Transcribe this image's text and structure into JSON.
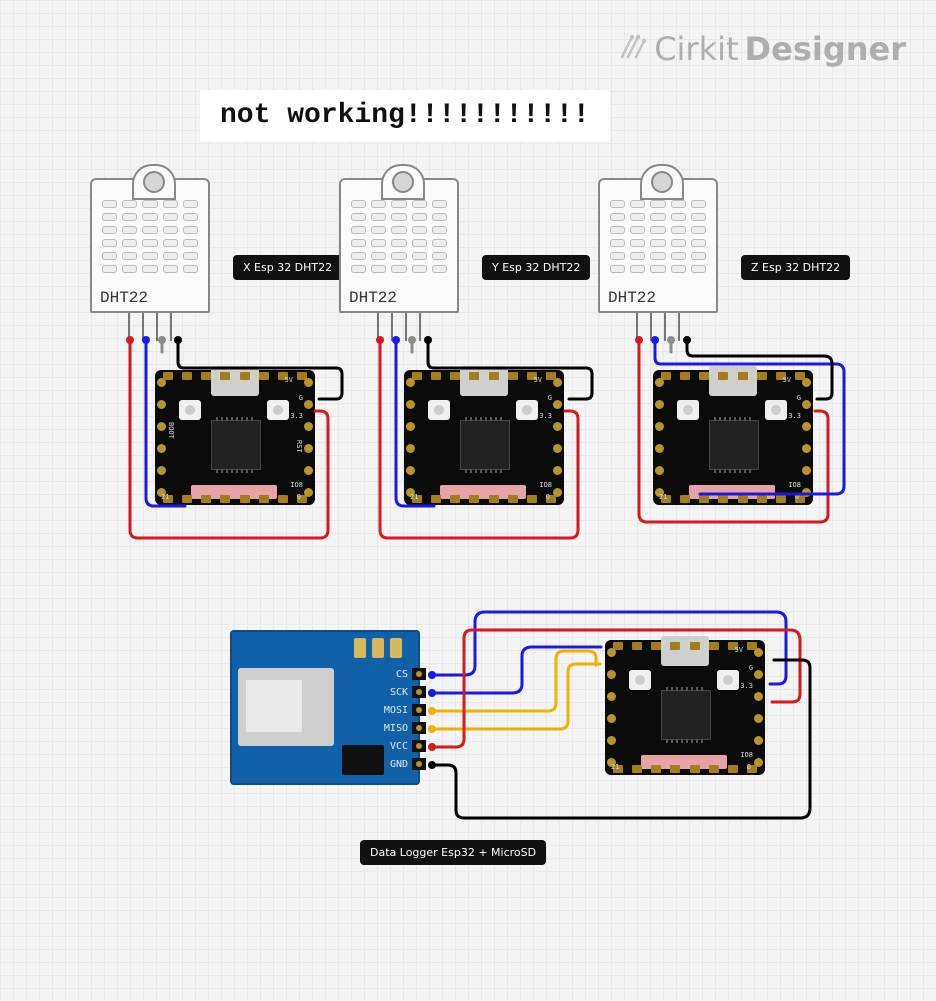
{
  "watermark": {
    "brand": "Cirkit",
    "product": "Designer"
  },
  "note": "not working!!!!!!!!!!!",
  "sensors": {
    "x": {
      "label": "DHT22",
      "chip_label": "X Esp 32 DHT22"
    },
    "y": {
      "label": "DHT22",
      "chip_label": "Y Esp 32 DHT22"
    },
    "z": {
      "label": "DHT22",
      "chip_label": "Z Esp 32 DHT22"
    }
  },
  "logger": {
    "label": "Data Logger Esp32 + MicroSD"
  },
  "sd_pins": {
    "cs": "CS",
    "sck": "SCK",
    "mosi": "MOSI",
    "miso": "MISO",
    "vcc": "VCC",
    "gnd": "GND"
  },
  "esp_pins": {
    "v5": "5V",
    "g": "G",
    "v33": "3.3",
    "rst": "RST",
    "io8": "IO8",
    "boot": "BOOT",
    "p21": "21",
    "p0": "0"
  },
  "wire_colors": {
    "vcc": "#d7191c",
    "data": "#1a1ae6",
    "nc": "#8c8c8c",
    "gnd": "#000000",
    "mosi": "#f0b000",
    "miso": "#f0b000"
  }
}
